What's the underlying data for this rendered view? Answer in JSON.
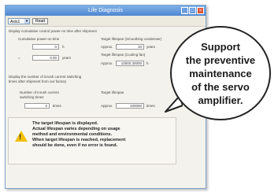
{
  "window": {
    "title": "Life Diagnosis",
    "toolbar": {
      "axis_select": "Axis1",
      "read_button": "Read"
    }
  },
  "cumulative": {
    "heading": "Display cumulative control power-on time after shipment",
    "cumulative_label": "Cumulative power-on time",
    "hours_value": "0",
    "hours_unit": "h",
    "years_eq": "=",
    "years_value": "0.00",
    "years_unit": "years",
    "target_lifespan_label": "Target lifespan (Smoothing condenser)",
    "approx1": "Approx.",
    "target_years": "10",
    "target_years_unit": "years",
    "fan_label": "Target lifespan (Cooling fan)",
    "approx2": "Approx.",
    "fan_hours": "10000.30000",
    "fan_unit": "h"
  },
  "inrush": {
    "heading": "Display the number of inrush current switching times after shipment from our factory",
    "count_label": "Number of inrush current switching times",
    "count_value": "0",
    "count_unit": "times",
    "target_label": "Target lifespan",
    "approx": "Approx.",
    "target_value": "100000",
    "target_unit": "times"
  },
  "warning": {
    "line1": "The target lifespan is displayed.",
    "line2": "Actual lifespan varies depending on usage",
    "line3": "method and environmental conditions.",
    "line4": "When target lifespan is reached, replacement",
    "line5": "should be done, even if no error is found."
  },
  "callout": {
    "line1": "Support",
    "line2": "the preventive",
    "line3": "maintenance",
    "line4": "of the servo",
    "line5": "amplifier."
  }
}
